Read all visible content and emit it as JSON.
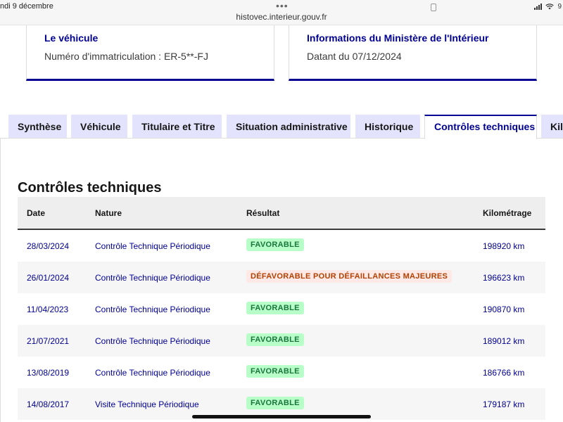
{
  "statusbar": {
    "date": "ndi 9 décembre",
    "url": "histovec.interieur.gouv.fr",
    "dots": "•••",
    "battery": "9"
  },
  "cards": [
    {
      "title": "Le véhicule",
      "text": "Numéro d'immatriculation : ER-5**-FJ"
    },
    {
      "title": "Informations du Ministère de l'Intérieur",
      "text": "Datant du 07/12/2024"
    }
  ],
  "tabs": [
    {
      "label": "Synthèse"
    },
    {
      "label": "Véhicule"
    },
    {
      "label": "Titulaire et Titre"
    },
    {
      "label": "Situation administrative"
    },
    {
      "label": "Historique"
    },
    {
      "label": "Contrôles techniques"
    },
    {
      "label": "Kil"
    }
  ],
  "section": {
    "title": "Contrôles techniques"
  },
  "table": {
    "headers": [
      "Date",
      "Nature",
      "Résultat",
      "Kilométrage"
    ],
    "rows": [
      {
        "date": "28/03/2024",
        "nature": "Contrôle Technique Périodique",
        "result": "FAVORABLE",
        "km": "198920 km"
      },
      {
        "date": "26/01/2024",
        "nature": "Contrôle Technique Périodique",
        "result": "DÉFAVORABLE POUR DÉFAILLANCES MAJEURES",
        "km": "196623 km"
      },
      {
        "date": "11/04/2023",
        "nature": "Contrôle Technique Périodique",
        "result": "FAVORABLE",
        "km": "190870 km"
      },
      {
        "date": "21/07/2021",
        "nature": "Contrôle Technique Périodique",
        "result": "FAVORABLE",
        "km": "189012 km"
      },
      {
        "date": "13/08/2019",
        "nature": "Contrôle Technique Périodique",
        "result": "FAVORABLE",
        "km": "186766 km"
      },
      {
        "date": "14/08/2017",
        "nature": "Visite Technique Périodique",
        "result": "FAVORABLE",
        "km": "179187 km"
      }
    ]
  },
  "colors": {
    "brand_blue": "#000091",
    "tab_bg": "#e3e3fd",
    "success_bg": "#b8fec9",
    "success_text": "#18753c",
    "error_bg": "#ffe9e6",
    "error_text": "#b34000"
  }
}
